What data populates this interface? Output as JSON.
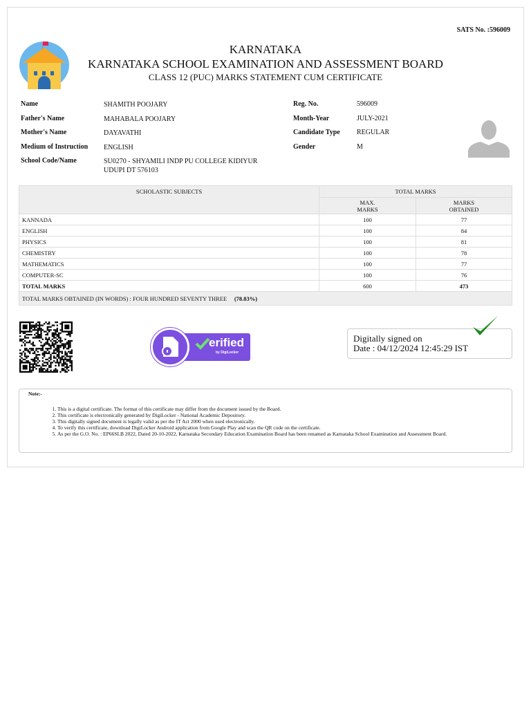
{
  "header": {
    "sats_label": "SATS No. :",
    "sats_value": "596009",
    "state": "KARNATAKA",
    "board": "KARNATAKA SCHOOL EXAMINATION AND ASSESSMENT BOARD",
    "certificate": "CLASS 12 (PUC) MARKS STATEMENT CUM CERTIFICATE"
  },
  "student": {
    "left": [
      {
        "label": "Name",
        "value": "SHAMITH POOJARY"
      },
      {
        "label": "Father's Name",
        "value": "MAHABALA POOJARY"
      },
      {
        "label": "Mother's Name",
        "value": "DAYAVATHI"
      },
      {
        "label": "Medium of Instruction",
        "value": "ENGLISH"
      },
      {
        "label": "School Code/Name",
        "value": "SU0270 - SHYAMILI INDP PU COLLEGE KIDIYUR",
        "value2": "UDUPI DT 576103"
      }
    ],
    "right": [
      {
        "label": "Reg. No.",
        "value": "596009"
      },
      {
        "label": "Month-Year",
        "value": "JULY-2021"
      },
      {
        "label": "Candidate Type",
        "value": "REGULAR"
      },
      {
        "label": "Gender",
        "value": "M"
      }
    ]
  },
  "marks": {
    "h_subjects": "SCHOLASTIC SUBJECTS",
    "h_total": "TOTAL MARKS",
    "h_max1": "MAX.",
    "h_max2": "MARKS",
    "h_obt1": "MARKS",
    "h_obt2": "OBTAINED",
    "rows": [
      {
        "subject": "KANNADA",
        "max": "100",
        "obtained": "77"
      },
      {
        "subject": "ENGLISH",
        "max": "100",
        "obtained": "84"
      },
      {
        "subject": "PHYSICS",
        "max": "100",
        "obtained": "81"
      },
      {
        "subject": "CHEMISTRY",
        "max": "100",
        "obtained": "78"
      },
      {
        "subject": "MATHEMATICS",
        "max": "100",
        "obtained": "77"
      },
      {
        "subject": "COMPUTER-SC",
        "max": "100",
        "obtained": "76"
      }
    ],
    "total": {
      "subject": "TOTAL MARKS",
      "max": "600",
      "obtained": "473"
    },
    "words": "TOTAL MARKS OBTAINED (IN WORDS) : FOUR HUNDRED SEVENTY THREE",
    "percent": "(78.83%)"
  },
  "badge": {
    "text": "erified",
    "sub": "by DigiLocker"
  },
  "signature": {
    "line1": "Digitally signed on",
    "line2": "Date : 04/12/2024 12:45:29 IST"
  },
  "notes": {
    "title": "Note:-",
    "items": [
      "This is a digital certificate. The format of this certificate may differ from the document issued by the Board.",
      "This certificate is electronically generated by DigiLocker - National Academic Depository.",
      "This digitally signed document is legally valid as per the IT Act 2000 when used electronically.",
      "To verify this certificate, download DigiLocker Android application from Google Play and scan the QR code on the certificate.",
      "As per the G.O. No. : EP66SLB 2022, Dated 20-10-2022, Karnataka Secondary Education Examination Board has been renamed as Karnataka School Examination and Assessment Board."
    ]
  },
  "colors": {
    "badge": "#7b4fe0",
    "check": "#1e8a1e"
  }
}
